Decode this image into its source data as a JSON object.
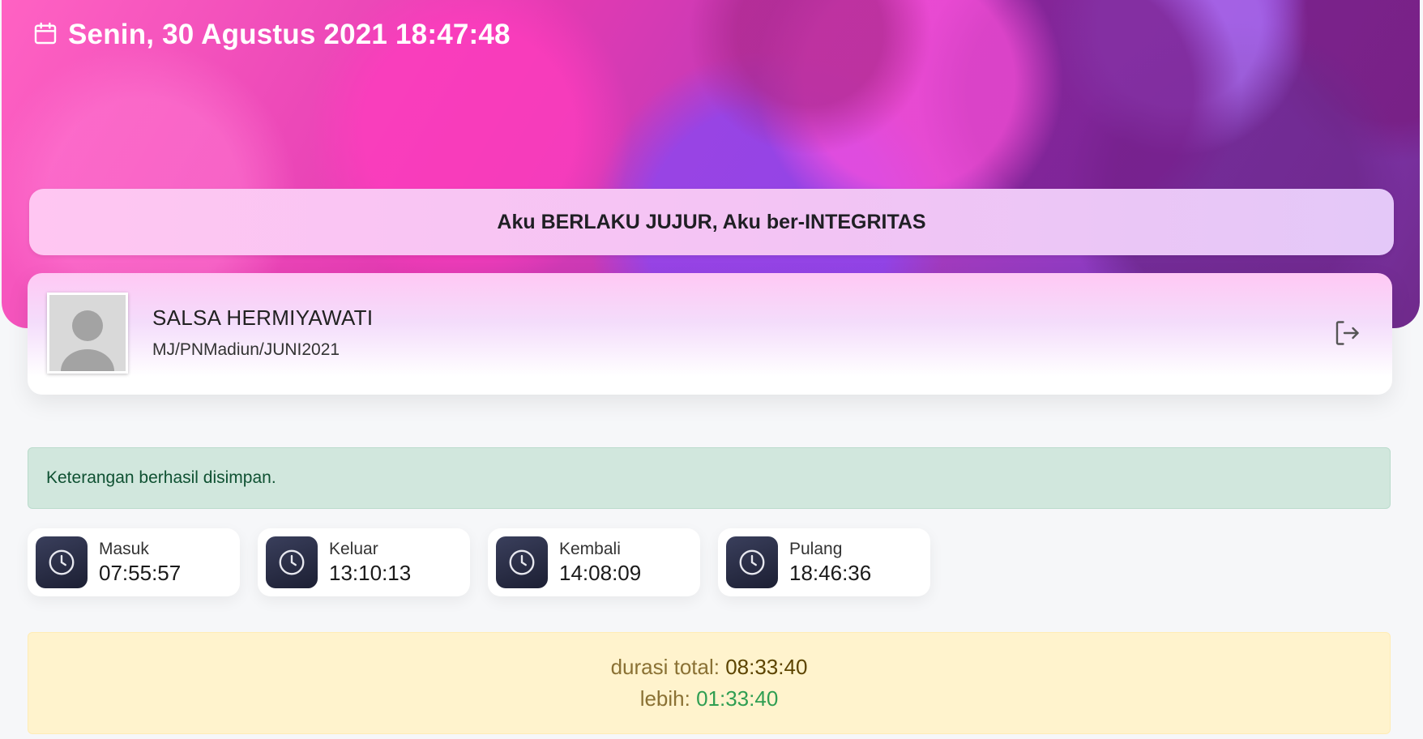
{
  "header": {
    "datetime": "Senin, 30 Agustus 2021 18:47:48"
  },
  "slogan": "Aku BERLAKU JUJUR, Aku ber-INTEGRITAS",
  "profile": {
    "name": "SALSA HERMIYAWATI",
    "id": "MJ/PNMadiun/JUNI2021"
  },
  "alert": "Keterangan berhasil disimpan.",
  "times": [
    {
      "label": "Masuk",
      "time": "07:55:57"
    },
    {
      "label": "Keluar",
      "time": "13:10:13"
    },
    {
      "label": "Kembali",
      "time": "14:08:09"
    },
    {
      "label": "Pulang",
      "time": "18:46:36"
    }
  ],
  "summary": {
    "total_label": "durasi total:",
    "total_value": "08:33:40",
    "lebih_label": "lebih:",
    "lebih_value": "01:33:40"
  },
  "icons": {
    "calendar": "calendar-icon",
    "logout": "logout-icon",
    "clock": "clock-icon",
    "avatar": "default-avatar"
  },
  "colors": {
    "alert_bg": "#d1e7dd",
    "alert_text": "#0f5132",
    "summary_bg": "#fff3cd",
    "lebih_text": "#2f9e52",
    "clock_box": "#23263d"
  }
}
